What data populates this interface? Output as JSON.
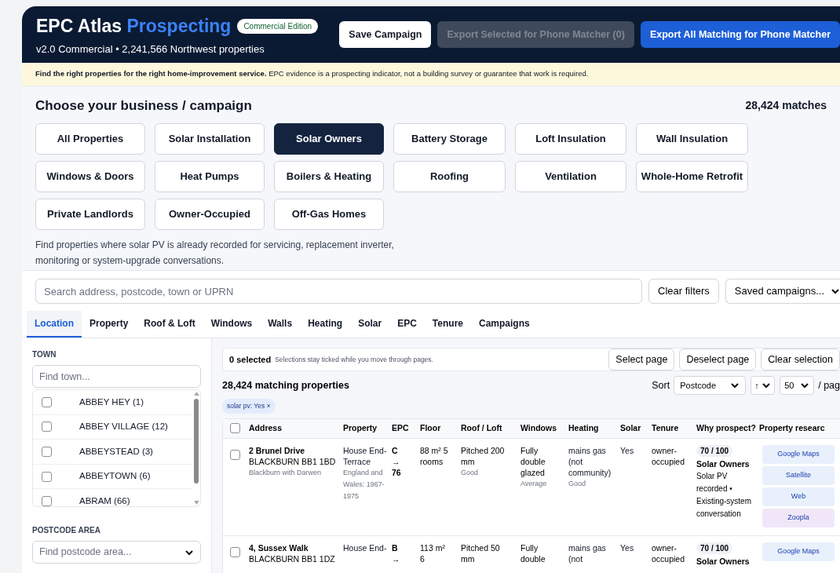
{
  "header": {
    "brand": "EPC Atlas",
    "brand_accent": "Prospecting",
    "edition_badge": "Commercial Edition",
    "subtitle": "v2.0 Commercial • 2,241,566 Northwest properties",
    "buttons": [
      {
        "label": "Save Campaign",
        "kind": "light"
      },
      {
        "label": "Export Selected for Phone Matcher (0)",
        "kind": "muted"
      },
      {
        "label": "Export All Matching for Phone Matcher",
        "kind": "primary"
      }
    ]
  },
  "notice": "**Find the right properties for the right home-improvement service.** EPC evidence is a prospecting indicator, not a building survey or guarantee that work is required.",
  "campaigns": {
    "title": "Choose your business / campaign",
    "match_count": "28,424 matches",
    "items": [
      {
        "label": "All Properties",
        "selected": false
      },
      {
        "label": "Solar Installation",
        "selected": false
      },
      {
        "label": "Solar Owners",
        "selected": true
      },
      {
        "label": "Battery Storage",
        "selected": false
      },
      {
        "label": "Loft Insulation",
        "selected": false
      },
      {
        "label": "Wall Insulation",
        "selected": false
      },
      {
        "label": "Windows & Doors",
        "selected": false
      },
      {
        "label": "Heat Pumps",
        "selected": false
      },
      {
        "label": "Boilers & Heating",
        "selected": false
      },
      {
        "label": "Roofing",
        "selected": false
      },
      {
        "label": "Ventilation",
        "selected": false
      },
      {
        "label": "Whole-Home Retrofit",
        "selected": false
      },
      {
        "label": "Private Landlords",
        "selected": false
      },
      {
        "label": "Owner-Occupied",
        "selected": false
      },
      {
        "label": "Off-Gas Homes",
        "selected": false
      }
    ],
    "description": "Find properties where solar PV is already recorded for servicing, replacement inverter, monitoring or system-upgrade conversations."
  },
  "search": {
    "placeholder": "Search address, postcode, town or UPRN",
    "clear_label": "Clear filters",
    "saved_label": "Saved campaigns..."
  },
  "filter_tabs": [
    {
      "label": "Location",
      "selected": true
    },
    {
      "label": "Property",
      "selected": false
    },
    {
      "label": "Roof & Loft",
      "selected": false
    },
    {
      "label": "Windows",
      "selected": false
    },
    {
      "label": "Walls",
      "selected": false
    },
    {
      "label": "Heating",
      "selected": false
    },
    {
      "label": "Solar",
      "selected": false
    },
    {
      "label": "EPC",
      "selected": false
    },
    {
      "label": "Tenure",
      "selected": false
    },
    {
      "label": "Campaigns",
      "selected": false
    }
  ],
  "sidebar": {
    "town_label": "TOWN",
    "town_placeholder": "Find town...",
    "towns": [
      {
        "label": "ABBEY HEY (1)",
        "checked": false
      },
      {
        "label": "ABBEY VILLAGE (12)",
        "checked": false
      },
      {
        "label": "ABBEYSTEAD (3)",
        "checked": false
      },
      {
        "label": "ABBEYTOWN (6)",
        "checked": false
      },
      {
        "label": "ABRAM (66)",
        "checked": false
      }
    ],
    "postcode_label": "POSTCODE AREA",
    "postcode_placeholder": "Find postcode area..."
  },
  "selection": {
    "count": "0 selected",
    "hint": "Selections stay ticked while you move through pages.",
    "buttons": [
      "Select page",
      "Deselect page",
      "Clear selection"
    ]
  },
  "results": {
    "title": "28,424 matching properties",
    "sort_label": "Sort",
    "sort_value": "Postcode",
    "direction_value": "↑",
    "page_size_value": "50",
    "page_suffix": "/ pag",
    "chips": [
      {
        "label": "solar pv: Yes",
        "remove": "×"
      }
    ]
  },
  "table": {
    "select_all_checked": false,
    "columns": [
      "Address",
      "Property",
      "EPC",
      "Floor",
      "Roof / Loft",
      "Windows",
      "Heating",
      "Solar",
      "Tenure",
      "Why prospect?",
      "Property researc"
    ],
    "rows": [
      {
        "checked": false,
        "street": "2 Brunel Drive",
        "postcode": "BLACKBURN BB1 1BD",
        "area": "Blackburn with Darwen",
        "property": "House End-Terrace",
        "property_note": "England and Wales: 1967-1975",
        "epc": "C → 76",
        "floor": "88 m² 5 rooms",
        "roof": "Pitched 200 mm",
        "roof_note": "Good",
        "windows": "Fully double glazed",
        "windows_note": "Average",
        "heating": "mains gas (not community)",
        "heating_note": "Good",
        "solar": "Yes",
        "tenure": "owner-occupied",
        "score": "70 / 100",
        "campaign": "Solar Owners",
        "reason": "Solar PV recorded • Existing-system conversation",
        "links": [
          {
            "label": "Google Maps",
            "color": "#e8f0fb"
          },
          {
            "label": "Satellite",
            "color": "#e8f0fb"
          },
          {
            "label": "Web",
            "color": "#e8f0fb"
          },
          {
            "label": "Zoopla",
            "color": "#f0e6f8"
          }
        ]
      },
      {
        "checked": false,
        "street": "4, Sussex Walk",
        "postcode": "BLACKBURN BB1 1DZ",
        "property": "House End-",
        "epc": "B →",
        "floor": "113 m² 6",
        "roof": "Pitched 50 mm",
        "windows": "Fully double",
        "heating": "mains gas (not",
        "solar": "Yes",
        "tenure": "owner-occupied",
        "score": "70 / 100",
        "campaign": "Solar Owners",
        "links": [
          {
            "label": "Google Maps",
            "color": "#e8f0fb"
          }
        ]
      }
    ]
  }
}
